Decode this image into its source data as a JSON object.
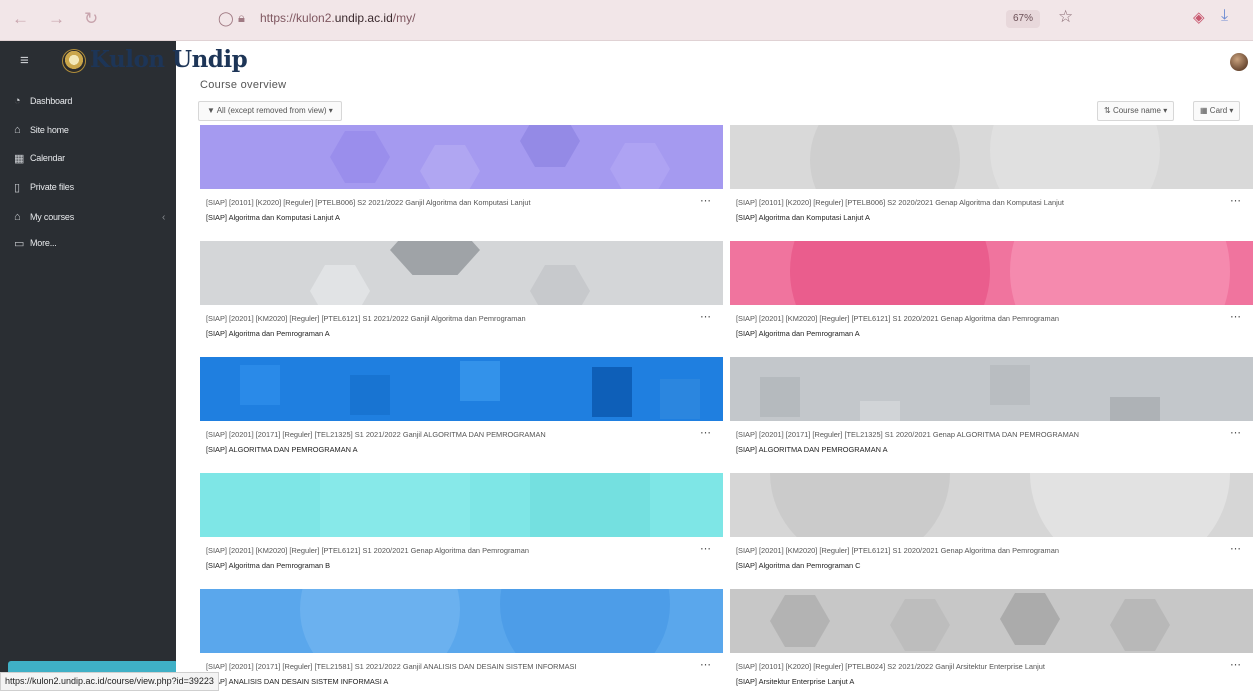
{
  "browser": {
    "url_prefix": "https://kulon2.",
    "url_host": "undip.ac.id",
    "url_suffix": "/my/",
    "zoom": "67%"
  },
  "header": {
    "brand": "Kulon Undip"
  },
  "sidebar": {
    "items": [
      {
        "label": "Dashboard",
        "icon": "dashboard-icon"
      },
      {
        "label": "Site home",
        "icon": "home-icon"
      },
      {
        "label": "Calendar",
        "icon": "calendar-icon"
      },
      {
        "label": "Private files",
        "icon": "file-icon"
      },
      {
        "label": "My courses",
        "icon": "graduation-cap-icon"
      },
      {
        "label": "More...",
        "icon": "folder-icon"
      }
    ]
  },
  "main": {
    "title": "Course overview",
    "filter_label": "All (except removed from view)",
    "sort_label": "Course name",
    "view_label": "Card"
  },
  "courses": [
    {
      "line1": "[SIAP] [20101] [K2020] [Reguler] [PTELB006] S2 2021/2022 Ganjil Algoritma dan Komputasi Lanjut",
      "line2": "[SIAP] Algoritma dan Komputasi Lanjut A"
    },
    {
      "line1": "[SIAP] [20101] [K2020] [Reguler] [PTELB006] S2 2020/2021 Genap Algoritma dan Komputasi Lanjut",
      "line2": "[SIAP] Algoritma dan Komputasi Lanjut A"
    },
    {
      "line1": "[SIAP] [20201] [KM2020] [Reguler] [PTEL6121] S1 2021/2022 Ganjil Algoritma dan Pemrograman",
      "line2": "[SIAP] Algoritma dan Pemrograman A"
    },
    {
      "line1": "[SIAP] [20201] [KM2020] [Reguler] [PTEL6121] S1 2020/2021 Genap Algoritma dan Pemrograman",
      "line2": "[SIAP] Algoritma dan Pemrograman A"
    },
    {
      "line1": "[SIAP] [20201] [20171] [Reguler] [TEL21325] S1 2021/2022 Ganjil ALGORITMA DAN PEMROGRAMAN",
      "line2": "[SIAP] ALGORITMA DAN PEMROGRAMAN A"
    },
    {
      "line1": "[SIAP] [20201] [20171] [Reguler] [TEL21325] S1 2020/2021 Genap ALGORITMA DAN PEMROGRAMAN",
      "line2": "[SIAP] ALGORITMA DAN PEMROGRAMAN A"
    },
    {
      "line1": "[SIAP] [20201] [KM2020] [Reguler] [PTEL6121] S1 2020/2021 Genap Algoritma dan Pemrograman",
      "line2": "[SIAP] Algoritma dan Pemrograman B"
    },
    {
      "line1": "[SIAP] [20201] [KM2020] [Reguler] [PTEL6121] S1 2020/2021 Genap Algoritma dan Pemrograman",
      "line2": "[SIAP] Algoritma dan Pemrograman C"
    },
    {
      "line1": "[SIAP] [20201] [20171] [Reguler] [TEL21581] S1 2021/2022 Ganjil ANALISIS DAN DESAIN SISTEM INFORMASI",
      "line2": "[SIAP] ANALISIS DAN DESAIN SISTEM INFORMASI A"
    },
    {
      "line1": "[SIAP] [20101] [K2020] [Reguler] [PTELB024] S2 2021/2022 Ganjil Arsitektur Enterprise Lanjut",
      "line2": "[SIAP] Arsitektur Enterprise Lanjut A"
    }
  ],
  "status_url": "https://kulon2.undip.ac.id/course/view.php?id=39223",
  "colors": {
    "sidebar_bg": "#2a2e33",
    "brand_color": "#1d3557",
    "card1": "#a59af0",
    "card2": "#d9d9d9",
    "card3": "#d4d6d8",
    "card4": "#f0749e",
    "card5": "#1f7fe0",
    "card6": "#c3c7cb",
    "card7": "#7ee6e6",
    "card8": "#d6d6d6",
    "card9": "#5aa7ec",
    "card10": "#c7c7c7"
  }
}
